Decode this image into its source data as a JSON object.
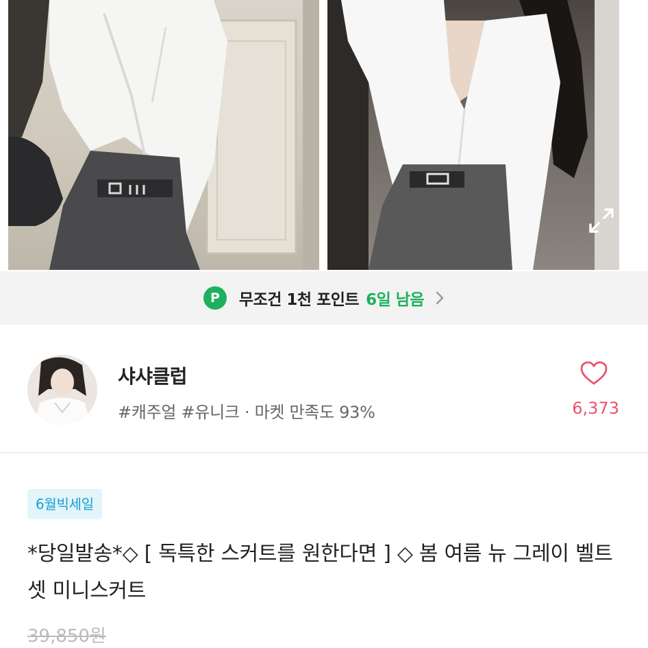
{
  "photos": {
    "left_alt": "model-photo-left",
    "right_alt": "model-photo-right",
    "expand_icon": "expand-icon"
  },
  "banner": {
    "badge": "P",
    "text": "무조건 1천 포인트",
    "remaining": "6일 남음",
    "chevron_icon": "chevron-right-icon",
    "accent_color": "#1db15d"
  },
  "shop": {
    "name": "샤샤클럽",
    "tags": "#캐주얼 #유니크 · 마켓 만족도 93%",
    "like_count": "6,373",
    "heart_icon": "heart-icon",
    "like_color": "#e8546a"
  },
  "product": {
    "badge": "6월빅세일",
    "title": "*당일발송*◇ [ 독특한 스커트를 원한다면 ] ◇  봄 여름 뉴 그레이 벨트 셋 미니스커트",
    "original_price": "39,850원"
  }
}
